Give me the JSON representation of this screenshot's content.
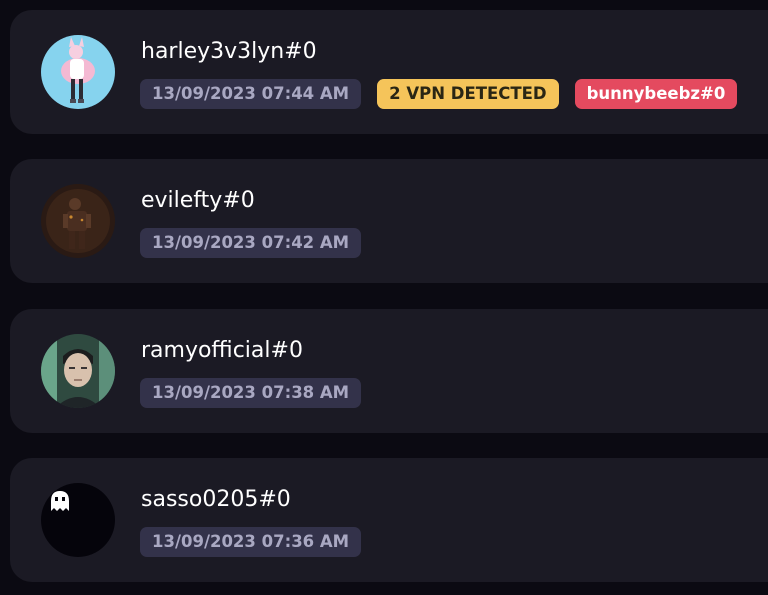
{
  "users": [
    {
      "username": "harley3v3lyn#0",
      "timestamp": "13/09/2023 07:44 AM",
      "vpn_badge": "2 VPN DETECTED",
      "linked_account": "bunnybeebz#0",
      "avatar": "anime-character-avatar"
    },
    {
      "username": "evilefty#0",
      "timestamp": "13/09/2023 07:42 AM",
      "avatar": "dark-figure-avatar"
    },
    {
      "username": "ramyofficial#0",
      "timestamp": "13/09/2023 07:38 AM",
      "avatar": "portrait-avatar"
    },
    {
      "username": "sasso0205#0",
      "timestamp": "13/09/2023 07:36 AM",
      "avatar": "ghost-icon-avatar"
    }
  ],
  "colors": {
    "background": "#0b0a12",
    "card": "#1b1a24",
    "timestamp_badge": "#33324a",
    "vpn_badge": "#f5c45a",
    "linked_badge": "#e44a5f"
  }
}
